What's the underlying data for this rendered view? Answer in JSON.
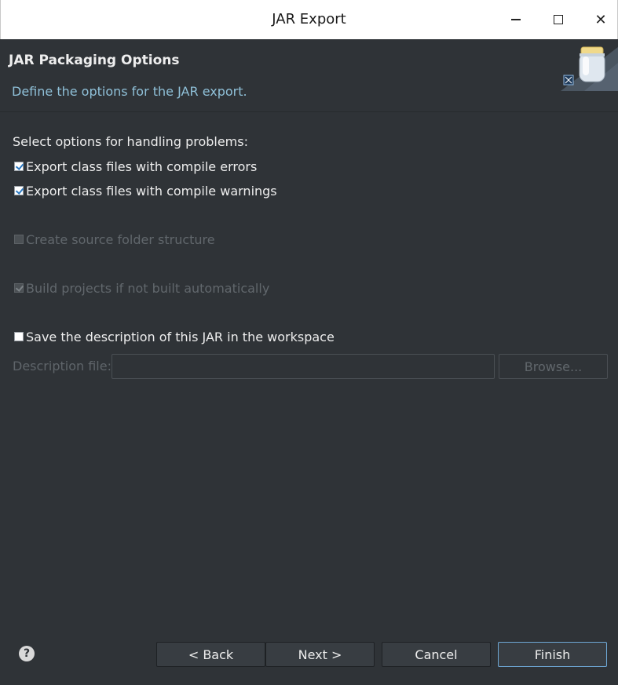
{
  "window": {
    "title": "JAR Export"
  },
  "header": {
    "title": "JAR Packaging Options",
    "description": "Define the options for the JAR export."
  },
  "problems": {
    "label": "Select options for handling problems:",
    "export_errors": {
      "label": "Export class files with compile errors",
      "checked": true
    },
    "export_warnings": {
      "label": "Export class files with compile warnings",
      "checked": true
    }
  },
  "options": {
    "create_source_folder": {
      "label": "Create source folder structure",
      "checked": false,
      "enabled": false
    },
    "build_projects": {
      "label": "Build projects if not built automatically",
      "checked": true,
      "enabled": false
    },
    "save_description": {
      "label": "Save the description of this JAR in the workspace",
      "checked": false
    }
  },
  "description_file": {
    "label": "Description file:",
    "value": "",
    "browse_label": "Browse..."
  },
  "footer": {
    "help_symbol": "?",
    "back_label": "< Back",
    "next_label": "Next >",
    "cancel_label": "Cancel",
    "finish_label": "Finish"
  },
  "icons": {
    "minimize": "minimize-icon",
    "maximize": "maximize-icon",
    "close": "close-icon",
    "close_glyph": "✕",
    "jar": "jar-icon",
    "help": "help-icon"
  },
  "colors": {
    "background": "#2f3337",
    "description_text": "#8fc0d8",
    "finish_border": "#6ea8d6",
    "disabled_text": "#61676c"
  }
}
